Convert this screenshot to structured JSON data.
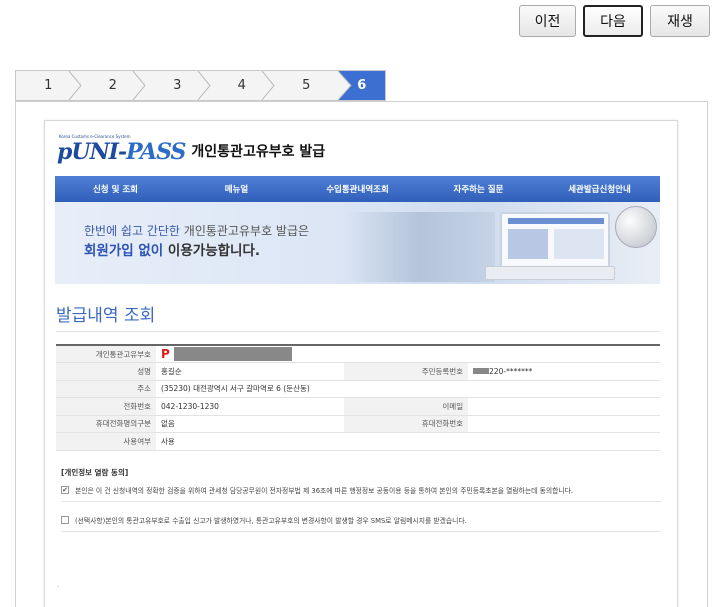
{
  "nav": {
    "prev_label": "이전",
    "next_label": "다음",
    "replay_label": "재생"
  },
  "steps": [
    "1",
    "2",
    "3",
    "4",
    "5",
    "6"
  ],
  "active_step": 6,
  "colors": {
    "accent": "#3d6fd3",
    "menubar": "#3a6ac6",
    "title": "#3a68c3",
    "id_marker": "#e01919"
  },
  "page": {
    "logo_tagline": "Korea Customs e-Clearance System",
    "logo_text_p": "pUNI-",
    "logo_text_rest": "PASS",
    "title": "개인통관고유부호 발급",
    "menu": [
      "신청 및 조회",
      "메뉴얼",
      "수입통관내역조회",
      "자주하는 질문",
      "세관발급신청안내"
    ],
    "banner": {
      "line1_a": "한번에 쉽고 ",
      "line1_b": "간단한",
      "line1_c": " 개인통관고유부호 발급은",
      "line2_a": "회원가입 없이",
      "line2_b": " 이용가능합니다."
    },
    "section_title": "발급내역 조회",
    "table": {
      "id_label": "개인통관고유부호",
      "id_prefix": "P",
      "name_label": "성명",
      "name_value": "홍길순",
      "ssn_label": "주민등록번호",
      "ssn_suffix": "220-*******",
      "address_label": "주소",
      "address_value": "(35230)  대전광역시 서구 갈마역로 6 (둔산동)",
      "phone_label": "전화번호",
      "phone_value": "042-1230-1230",
      "email_label": "이메일",
      "email_value": "",
      "mobile_owner_label": "휴대전화명의구분",
      "mobile_owner_value": "없음",
      "mobile_label": "휴대전화번호",
      "mobile_value": "",
      "usage_label": "사용여부",
      "usage_value": "사용"
    },
    "consent": {
      "title": "[개인정보 열람 동의]",
      "item1": "본인은 이 건 신청내역의 정확한 검증을 위하여 관세청 담당공무원이 전자정부법 제 36조에 따른 행정정보 공동이용 등을 통하여 본인의 주민등록초본을 열람하는데 동의합니다.",
      "item1_checked": true,
      "item2": "(선택사항)본인의 통관고유부호로 수출입 신고가 발생하였거나, 통관고유부호의 변경사항이 발생할 경우 SMS로 알림메시지를 받겠습니다.",
      "item2_checked": false
    }
  }
}
